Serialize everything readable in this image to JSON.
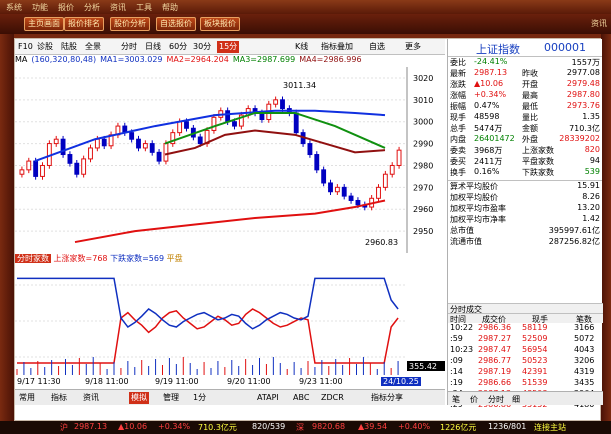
{
  "menu": [
    "系统",
    "功能",
    "报价",
    "分析",
    "资讯",
    "工具",
    "帮助"
  ],
  "toolbar_buttons": [
    "主页画面",
    "报价排名",
    "股价分析",
    "自选报价",
    "板块报价"
  ],
  "toolbar_right": "资讯",
  "chart_toolbar": {
    "code": "F10",
    "items": [
      "诊股",
      "陆股",
      "全景",
      "分时",
      "日线",
      "60分",
      "30分",
      "15分",
      "K线",
      "指标叠加",
      "自选",
      "更多"
    ],
    "selected": "15分"
  },
  "ma_legend": {
    "label": "MA",
    "params": "(160,320,80,48)",
    "ma1": "MA1=3003.029",
    "ma2": "MA2=2964.204",
    "ma3": "MA3=2987.699",
    "ma4": "MA4=2986.996"
  },
  "colors": {
    "ma1": "#1030e0",
    "ma2": "#e01010",
    "ma3": "#109010",
    "ma4": "#901010",
    "up": "#e01010",
    "down": "#0000c0"
  },
  "annotations": {
    "high": "3011.34",
    "low": "2960.83"
  },
  "indicator": {
    "name": "分时家数",
    "up_label": "上涨家数=768",
    "down_label": "下跌家数=569",
    "extra": "平盘",
    "right_value": "355.42"
  },
  "chart_data": {
    "type": "line",
    "y_ticks": [
      3020,
      3010,
      3000,
      2990,
      2980,
      2970,
      2960,
      2950
    ],
    "x_labels": [
      "9/17 11:30",
      "9/18 11:00",
      "9/19 11:00",
      "9/20 11:00",
      "9/23 11:00",
      "24/10.25"
    ],
    "ylim": [
      2940,
      3025
    ]
  },
  "bottom_tabs": [
    "常用",
    "指标",
    "资讯",
    "模拟",
    "管理",
    "1分",
    "ATAPI",
    "ABC",
    "ZDCR",
    "指标分享"
  ],
  "bottom_selected": "模拟",
  "quote": {
    "name": "上证指数",
    "code": "000001",
    "rows": [
      {
        "l1": "委比",
        "v1": "-24.41%",
        "c1": "green",
        "l2": "",
        "v2": "1557万",
        "c2": "black"
      },
      {
        "l1": "最新",
        "v1": "2987.13",
        "c1": "red",
        "l2": "昨收",
        "v2": "2977.08",
        "c2": "black"
      },
      {
        "l1": "涨跌",
        "v1": "▲10.06",
        "c1": "red",
        "l2": "开盘",
        "v2": "2979.48",
        "c2": "red"
      },
      {
        "l1": "涨幅",
        "v1": "+0.34%",
        "c1": "red",
        "l2": "最高",
        "v2": "2987.80",
        "c2": "red"
      },
      {
        "l1": "振幅",
        "v1": "0.47%",
        "c1": "black",
        "l2": "最低",
        "v2": "2973.76",
        "c2": "red"
      },
      {
        "l1": "现手",
        "v1": "48598",
        "c1": "black",
        "l2": "量比",
        "v2": "1.35",
        "c2": "black"
      },
      {
        "l1": "总手",
        "v1": "5474万",
        "c1": "black",
        "l2": "金额",
        "v2": "710.3亿",
        "c2": "black"
      },
      {
        "l1": "内盘",
        "v1": "26401472",
        "c1": "green",
        "l2": "外盘",
        "v2": "28339202",
        "c2": "red"
      },
      {
        "l1": "委卖",
        "v1": "3968万",
        "c1": "black",
        "l2": "上涨家数",
        "v2": "820",
        "c2": "red"
      },
      {
        "l1": "委买",
        "v1": "2411万",
        "c1": "black",
        "l2": "平盘家数",
        "v2": "94",
        "c2": "black"
      },
      {
        "l1": "换手",
        "v1": "0.16%",
        "c1": "black",
        "l2": "下跌家数",
        "v2": "539",
        "c2": "green"
      }
    ],
    "stats": [
      {
        "l": "算术平均股价",
        "v": "15.91"
      },
      {
        "l": "加权平均股价",
        "v": "8.26"
      },
      {
        "l": "加权平均市盈率",
        "v": "13.20"
      },
      {
        "l": "加权平均市净率",
        "v": "1.42"
      },
      {
        "l": "总市值",
        "v": "395997.61亿"
      },
      {
        "l": "流通市值",
        "v": "287256.82亿"
      }
    ]
  },
  "trades": {
    "headers": [
      "时间",
      "成交价",
      "现手",
      "笔数"
    ],
    "title": "分时成交",
    "rows": [
      {
        "t": "10:22",
        "p": "2986.36",
        "q": "58119",
        "n": "3166"
      },
      {
        "t": ":59",
        "p": "2987.27",
        "q": "52509",
        "n": "5072"
      },
      {
        "t": "10:23",
        "p": "2987.47",
        "q": "56954",
        "n": "4043"
      },
      {
        "t": ":09",
        "p": "2986.77",
        "q": "50523",
        "n": "3206"
      },
      {
        "t": ":14",
        "p": "2987.19",
        "q": "42391",
        "n": "4319"
      },
      {
        "t": ":19",
        "p": "2986.66",
        "q": "51539",
        "n": "3435"
      },
      {
        "t": ":24",
        "p": "2987.13",
        "q": "48598",
        "n": "2964"
      },
      {
        "t": ":29",
        "p": "2986.86",
        "q": "55152",
        "n": "4180"
      }
    ]
  },
  "right_tabs": [
    "笔",
    "价",
    "分时",
    "细"
  ],
  "status": {
    "name": "沪",
    "price": "2987.13",
    "change": "▲10.06",
    "pct": "+0.34%",
    "amount": "710.3亿元",
    "ud": "820/539",
    "sz": "深",
    "sz_price": "9820.68",
    "sz_change": "▲39.54",
    "sz_pct": "+0.40%",
    "sz_amount": "1226亿元",
    "sz_ud": "1236/801",
    "conn": "连接主站"
  }
}
